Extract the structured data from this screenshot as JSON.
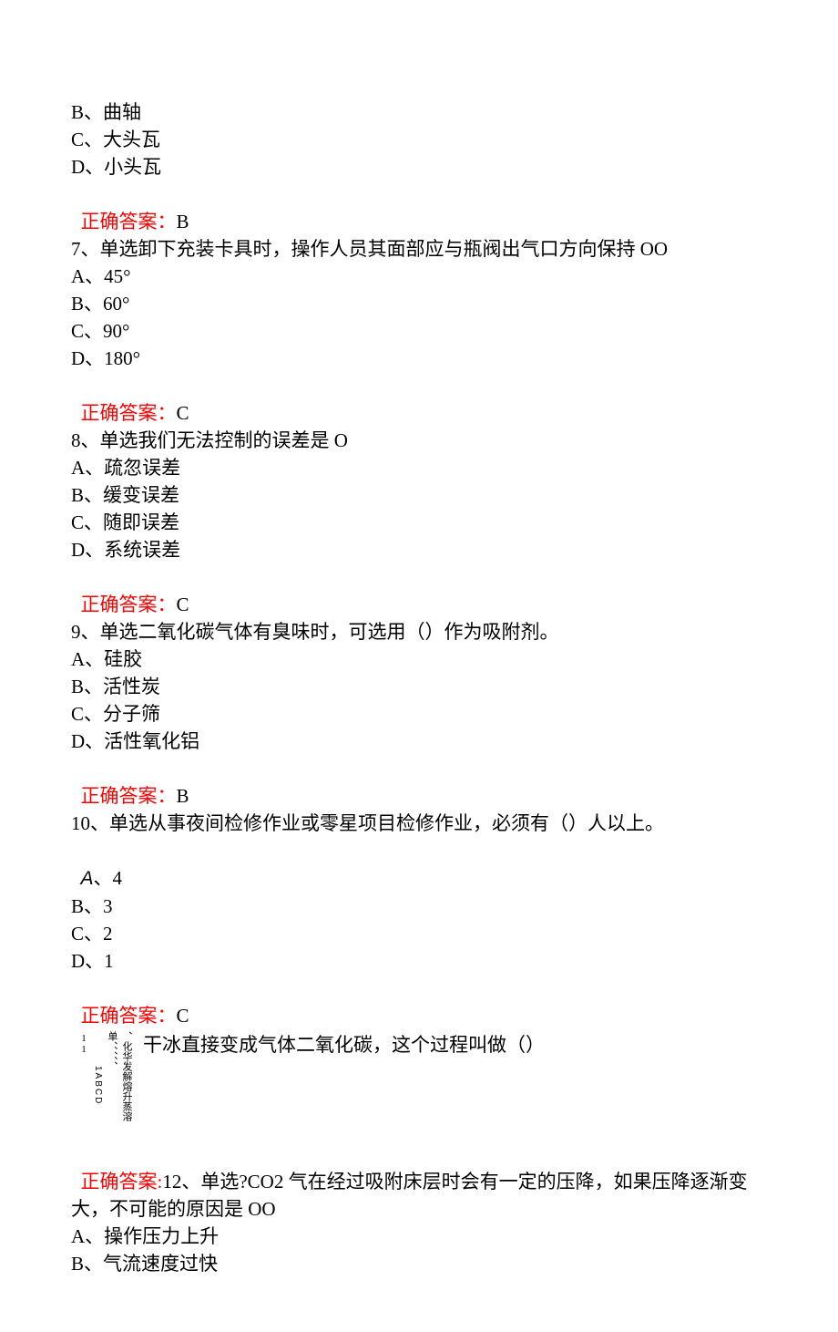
{
  "q6": {
    "optB": "B、曲轴",
    "optC": "C、大头瓦",
    "optD": "D、小头瓦",
    "answer_label": "正确答案：",
    "answer_value": "B"
  },
  "q7": {
    "stem": "7、单选卸下充装卡具时，操作人员其面部应与瓶阀出气口方向保持 OO",
    "optA": "A、45°",
    "optB": "B、60°",
    "optC": "C、90°",
    "optD": "D、180°",
    "answer_label": "正确答案：",
    "answer_value": "C"
  },
  "q8": {
    "stem": "8、单选我们无法控制的误差是 O",
    "optA": "A、疏忽误差",
    "optB": "B、缓变误差",
    "optC": "C、随即误差",
    "optD": "D、系统误差",
    "answer_label": "正确答案：",
    "answer_value": "C"
  },
  "q9": {
    "stem": "9、单选二氧化碳气体有臭味时，可选用（）作为吸附剂。",
    "optA": "A、硅胶",
    "optB": "B、活性炭",
    "optC": "C、分子筛",
    "optD": "D、活性氧化铝",
    "answer_label": "正确答案：",
    "answer_value": "B"
  },
  "q10": {
    "stem": "10、单选从事夜间检修作业或零星项目检修作业，必须有（）人以上。",
    "optA_letter": "A",
    "optA_rest": "、4",
    "optB": "B、3",
    "optC": "C、2",
    "optD": "D、1",
    "answer_label": "正确答案：",
    "answer_value": "C"
  },
  "q11": {
    "num_col": "11",
    "letters_col": "1ABCD",
    "marks_col": "单、、、、、",
    "options_col": "、化华发解熔升蒸溶",
    "stem_right": "干冰直接变成气体二氧化碳，这个过程叫做（）"
  },
  "q12": {
    "answer_label": "正确答案:",
    "stem_line1": "12、单选?CO2 气在经过吸附床层时会有一定的压降，如果压降逐渐变",
    "stem_line2": "大，不可能的原因是 OO",
    "optA": "A、操作压力上升",
    "optB": "B、气流速度过快"
  }
}
